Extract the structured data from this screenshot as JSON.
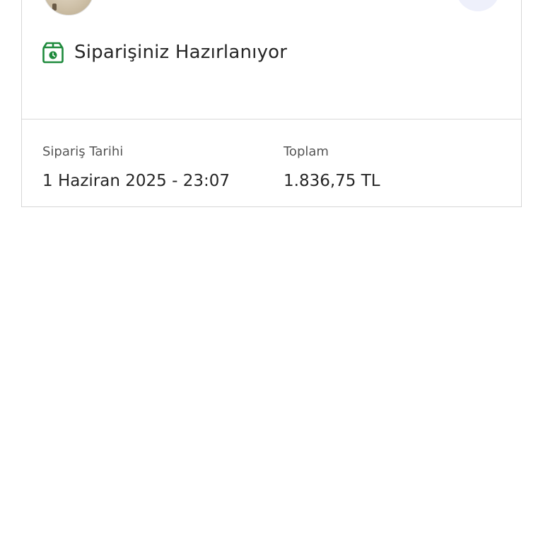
{
  "order": {
    "status_text": "Siparişiniz Hazırlanıyor",
    "status_icon": "package-preparing-icon",
    "accent_color": "#1e8a3c",
    "date_label": "Sipariş Tarihi",
    "date_value": "1 Haziran 2025 - 23:07",
    "total_label": "Toplam",
    "total_value": "1.836,75 TL"
  },
  "icons": {
    "thumbnail": "product-thumbnail",
    "action": "action-button-circle"
  }
}
